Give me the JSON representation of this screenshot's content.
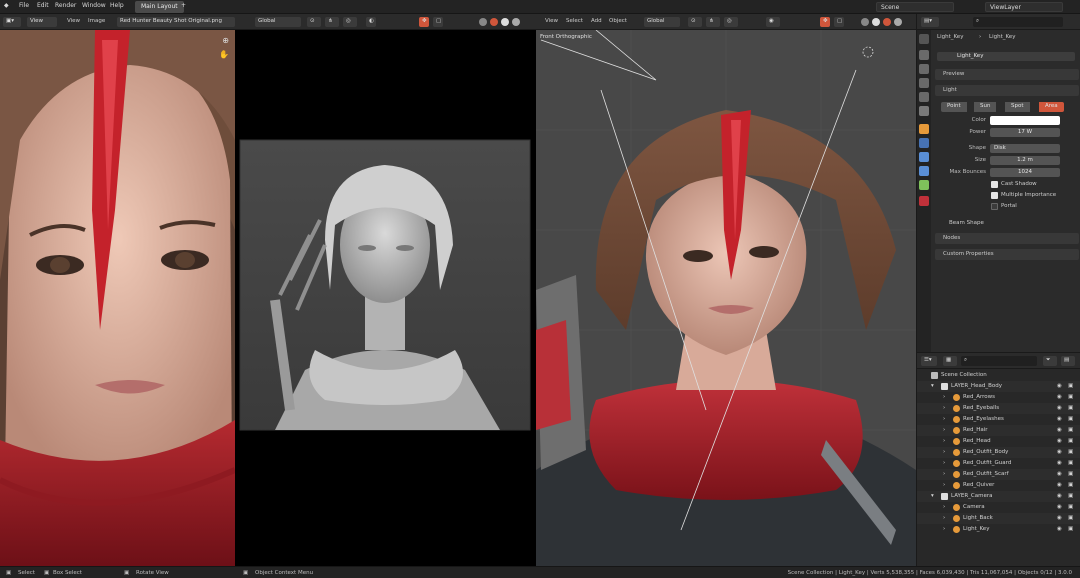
{
  "menu": {
    "file": "File",
    "edit": "Edit",
    "render": "Render",
    "window": "Window",
    "help": "Help"
  },
  "workspace_tabs": {
    "main": "Main Layout"
  },
  "scene": {
    "scene_name": "Scene",
    "view_layer": "ViewLayer"
  },
  "image_editor": {
    "view": "View",
    "view2": "View",
    "image": "Image",
    "image_name": "Red Hunter Beauty Shot Original.png"
  },
  "viewport": {
    "view": "View",
    "select": "Select",
    "add": "Add",
    "object": "Object",
    "orientation": "Global",
    "overlay_label": "Front Orthographic"
  },
  "middle_header": {
    "orientation": "Global"
  },
  "properties": {
    "breadcrumb_obj": "Light_Key",
    "breadcrumb_data": "Light_Key",
    "datablock": "Light_Key",
    "panel_preview": "Preview",
    "panel_light": "Light",
    "types": [
      "Point",
      "Sun",
      "Spot",
      "Area"
    ],
    "active_type": "Area",
    "color_label": "Color",
    "power_label": "Power",
    "power_value": "17 W",
    "shape_label": "Shape",
    "shape_value": "Disk",
    "size_label": "Size",
    "size_value": "1.2 m",
    "max_bounces_label": "Max Bounces",
    "max_bounces_value": "1024",
    "cast_shadow": "Cast Shadow",
    "multiple_importance": "Multiple Importance",
    "portal": "Portal",
    "beam_shape": "Beam Shape",
    "nodes": "Nodes",
    "custom_properties": "Custom Properties",
    "light_color": "#ffffff"
  },
  "outliner": {
    "root": "Scene Collection",
    "collections": [
      {
        "name": "LAYER_Head_Body",
        "items": [
          "Red_Arrows",
          "Red_Eyeballs",
          "Red_Eyelashes",
          "Red_Hair",
          "Red_Head",
          "Red_Outfit_Body",
          "Red_Outfit_Guard",
          "Red_Outfit_Scarf",
          "Red_Quiver"
        ]
      },
      {
        "name": "LAYER_Camera",
        "items": [
          "Camera",
          "Light_Back",
          "Light_Key"
        ]
      }
    ]
  },
  "statusbar": {
    "select": "Select",
    "box_select": "Box Select",
    "rotate_view": "Rotate View",
    "context_menu": "Object Context Menu",
    "stats": "Scene Collection | Light_Key | Verts 5,538,355 | Faces 6,039,430 | Tris 11,067,054 | Objects 0/12 | 3.0.0"
  },
  "colors": {
    "accent": "#d0563b",
    "active_blue": "#4772b3",
    "mesh_icon": "#e69a3a",
    "light_icon": "#7fc15b"
  }
}
